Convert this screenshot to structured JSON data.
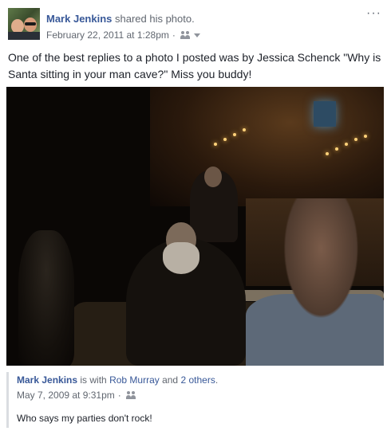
{
  "post": {
    "author": "Mark Jenkins",
    "action_pre": " shared his ",
    "action_link": "photo",
    "action_post": ".",
    "date": "February 22, 2011 at 1:28pm",
    "separator": "·",
    "privacy_icon": "friends-icon",
    "more_label": "···",
    "text": "One of the best replies to a photo I posted was by Jessica Schenck \"Why is Santa sitting in your man cave?\" Miss you buddy!"
  },
  "shared": {
    "author": "Mark Jenkins",
    "with_text": " is with ",
    "with_person": "Rob Murray",
    "and_text": " and ",
    "others": "2 others",
    "end": ".",
    "date": "May 7, 2009 at 9:31pm",
    "separator": "·",
    "privacy_icon": "friends-icon",
    "caption": "Who says my parties don't rock!"
  },
  "colors": {
    "link": "#385898",
    "meta": "#616770",
    "text": "#1d2129"
  }
}
